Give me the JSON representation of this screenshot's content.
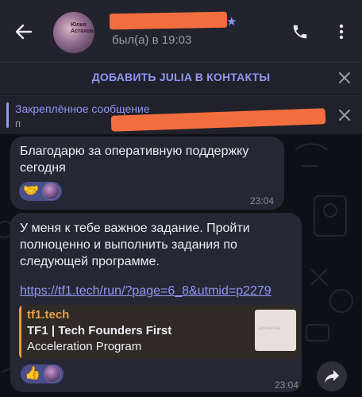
{
  "header": {
    "avatar_text": "Юлия\nАстахова",
    "status": "был(а) в 19:03",
    "colors": {
      "bar": "#22232e",
      "accent": "#8f97f2",
      "redaction": "#f36e3e"
    }
  },
  "add_contact": {
    "label": "ДОБАВИТЬ JULIA В КОНТАКТЫ"
  },
  "pinned": {
    "title": "Закреплённое сообщение",
    "text": "п"
  },
  "messages": [
    {
      "text": "Благодарю за оперативную поддержку сегодня",
      "reaction_emoji": "🤝",
      "time": "23:04"
    },
    {
      "text": "У меня к тебе важное задание. Пройти полноценно и выполнить задания по следующей программе.",
      "link": "https://tf1.tech/run/?page=6_8&utmid=p2279",
      "preview": {
        "site": "tf1.tech",
        "title": "TF1 | Tech Founders First",
        "description": "Acceleration Program",
        "thumb_text": "accelerate"
      },
      "reaction_emoji": "👍",
      "time": "23:04"
    }
  ],
  "icons": [
    "arrow-left-icon",
    "verified-star-icon",
    "phone-icon",
    "more-vertical-icon",
    "close-icon",
    "forward-icon"
  ]
}
